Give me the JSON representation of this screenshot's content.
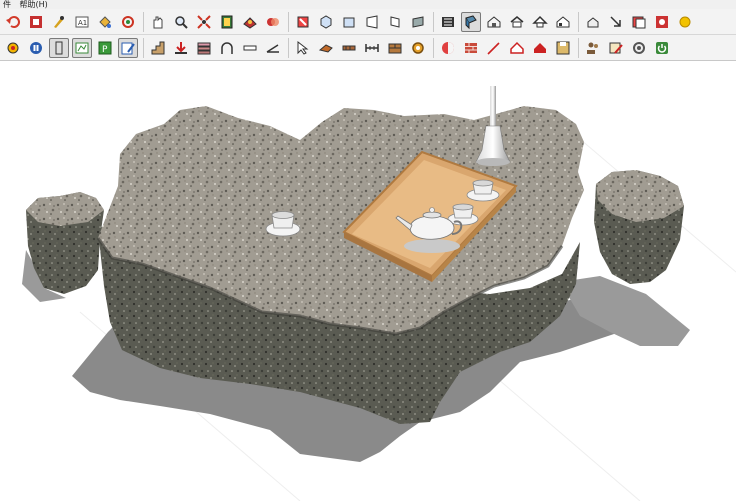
{
  "menu": {
    "file_fragment": "件",
    "help": "帮助(H)"
  },
  "toolbar_row1": [
    "undo-icon",
    "stop-icon",
    "edit-icon",
    "text-icon",
    "paint-bucket-icon",
    "orbit-icon",
    "hand-icon",
    "zoom-icon",
    "zoom-extents-icon",
    "component-icon",
    "material-icon",
    "style-icon",
    "iso-view-icon",
    "top-view-icon",
    "front-view-icon",
    "right-view-icon",
    "back-view-icon",
    "left-view-icon",
    "xray-icon",
    "wireframe-icon",
    "house-icon",
    "house-outline-icon",
    "roof-icon",
    "house-alt-icon",
    "house-small-icon",
    "arrow-icon",
    "layers-icon",
    "redo-icon",
    "dot-icon"
  ],
  "toolbar_row2": [
    "orbit-dot-icon",
    "pause-icon",
    "column-icon",
    "sketch-icon",
    "scene-p-icon",
    "edit-page-icon",
    "stair-icon",
    "push-down-icon",
    "stack-icon",
    "arc-icon",
    "line-icon",
    "angle-icon",
    "pointer-icon",
    "rocket-icon",
    "pipe-icon",
    "dimension-icon",
    "brick-box-icon",
    "gear-icon",
    "swatch-icon",
    "brick-icon",
    "stairs-red-icon",
    "house-red-icon",
    "house-solid-icon",
    "floppy-icon",
    "people-icon",
    "image-edit-icon",
    "wrench-icon",
    "power-icon"
  ],
  "active_tools": [
    "column-icon",
    "sketch-icon",
    "edit-page-icon",
    "wireframe-icon"
  ],
  "scene": {
    "objects": [
      "stone-table",
      "stone-stool-left",
      "stone-stool-right",
      "wooden-tray",
      "teapot",
      "teacup-left",
      "teacup-tray-1",
      "teacup-tray-2",
      "vase"
    ],
    "colors": {
      "stone_light": "#a39e93",
      "stone_dark": "#4f5048",
      "tray": "#d9a66e",
      "shadow": "#8c8c8c",
      "porcelain": "#f2f2f2"
    }
  }
}
